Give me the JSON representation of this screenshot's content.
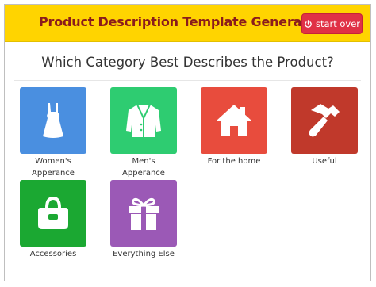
{
  "header": {
    "title": "Product Description Template Generator",
    "start_over_label": "start over",
    "start_over_icon": "power-icon"
  },
  "question": "Which Category Best Describes the Product?",
  "categories": [
    {
      "label": "Women's Apperance",
      "icon": "dress-icon",
      "color": "#4a8fe0"
    },
    {
      "label": "Men's Apperance",
      "icon": "jacket-icon",
      "color": "#2ecc71"
    },
    {
      "label": "For the home",
      "icon": "house-icon",
      "color": "#e84c3d"
    },
    {
      "label": "Useful",
      "icon": "hammer-icon",
      "color": "#c0392b"
    },
    {
      "label": "Accessories",
      "icon": "handbag-icon",
      "color": "#1ba832"
    },
    {
      "label": "Everything Else",
      "icon": "gift-icon",
      "color": "#9b59b6"
    }
  ]
}
